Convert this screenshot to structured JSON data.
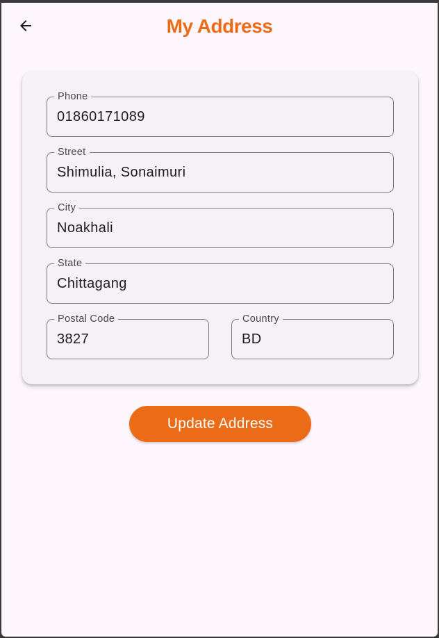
{
  "header": {
    "title": "My Address",
    "back_icon": "arrow-left-icon"
  },
  "form": {
    "phone": {
      "label": "Phone",
      "value": "01860171089"
    },
    "street": {
      "label": "Street",
      "value": "Shimulia, Sonaimuri"
    },
    "city": {
      "label": "City",
      "value": "Noakhali"
    },
    "state": {
      "label": "State",
      "value": "Chittagang"
    },
    "postal": {
      "label": "Postal Code",
      "value": "3827"
    },
    "country": {
      "label": "Country",
      "value": "BD"
    }
  },
  "actions": {
    "update_label": "Update Address"
  },
  "colors": {
    "accent": "#ec6b17",
    "background": "#fdf7fd",
    "card": "#f4f2f7"
  }
}
